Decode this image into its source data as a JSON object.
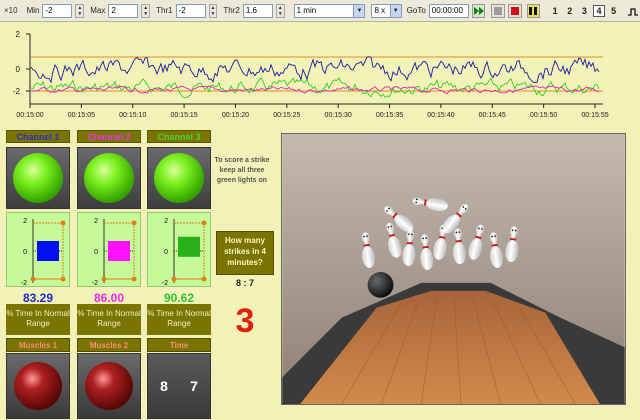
{
  "toolbar": {
    "zoom_label": "×10",
    "min_label": "Min",
    "min_value": "-2",
    "max_label": "Max",
    "max_value": "2",
    "thr1_label": "Thr1",
    "thr1_value": "-2",
    "thr2_label": "Thr2",
    "thr2_value": "1.6",
    "timebase_value": "1 min",
    "speed_value": "8 x",
    "goto_label": "GoTo",
    "goto_value": "00:00:00",
    "channel_numbers": [
      "1",
      "2",
      "3",
      "4",
      "5"
    ],
    "active_channel": "4"
  },
  "graph": {
    "y_ticks": [
      "2",
      "0",
      "-2"
    ],
    "time_ticks": [
      "00:15:00",
      "00:15:05",
      "00:15:10",
      "00:15:15",
      "00:15:20",
      "00:15:25",
      "00:15:30",
      "00:15:35",
      "00:15:40",
      "00:15:45",
      "00:15:50",
      "00:15:55"
    ],
    "colors": {
      "channel1": "#1a1aa0",
      "channel2": "#e020c0",
      "channel3": "#30d020",
      "threshold": "#e09020"
    }
  },
  "channels": [
    {
      "title": "Channel 1",
      "title_color": "#2830c0",
      "percent": "83.29",
      "percent_color": "#1a2ad0",
      "bar_color": "#0010f0",
      "bar_value": 0
    },
    {
      "title": "Channel 2",
      "title_color": "#f030f0",
      "percent": "86.00",
      "percent_color": "#f028f0",
      "bar_color": "#ff10ff",
      "bar_value": 0
    },
    {
      "title": "Channel 3",
      "title_color": "#4cd040",
      "percent": "90.62",
      "percent_color": "#30c030",
      "bar_color": "#28b018",
      "bar_value": 0.3
    }
  ],
  "plot_ticks": {
    "top": "2",
    "mid": "0",
    "bottom": "-2"
  },
  "percent_caption": "% Time In Normal Range",
  "instruction": "To score a strike keep all three green lights on",
  "question": "How many strikes in 4 minutes?",
  "score_ratio": "8 : 7",
  "strikes": "3",
  "bottom": {
    "muscles1": "Muscles 1",
    "muscles2": "Muscles 2",
    "time_title": "Time",
    "time_left": "8",
    "time_right": "7"
  }
}
